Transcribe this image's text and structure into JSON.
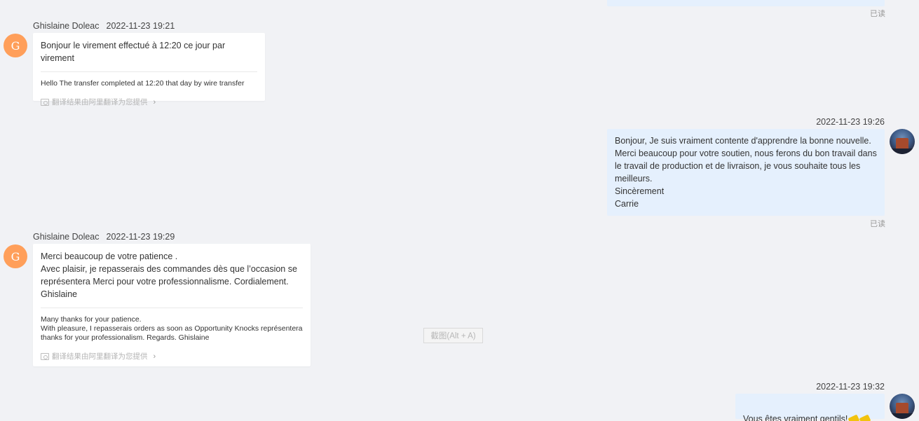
{
  "top": {
    "read_status": "已读"
  },
  "messages": [
    {
      "sender": "Ghislaine Doleac",
      "time": "2022-11-23 19:21",
      "avatar_letter": "G",
      "original": "Bonjour le virement effectué à 12:20 ce jour par virement",
      "translation": "Hello The transfer completed at 12:20 that day by wire transfer",
      "credit": "翻译结果由阿里翻译为您提供"
    },
    {
      "time": "2022-11-23 19:26",
      "text": "Bonjour, Je suis vraiment contente d'apprendre la bonne nouvelle.\nMerci beaucoup pour votre soutien, nous ferons du bon travail dans\nle travail de production et de livraison, je vous souhaite tous les\nmeilleurs.\nSincèrement\nCarrie",
      "read_status": "已读"
    },
    {
      "sender": "Ghislaine Doleac",
      "time": "2022-11-23 19:29",
      "avatar_letter": "G",
      "original": "Merci beaucoup de votre patience .\nAvec plaisir, je repasserais des commandes dès que l’occasion se\nreprésentera Merci pour votre professionnalisme. Cordialement.\nGhislaine",
      "translation": "Many thanks for your patience.\nWith pleasure, I repasserais orders as soon as Opportunity Knocks représentera\nthanks for your professionalism. Regards. Ghislaine",
      "credit": "翻译结果由阿里翻译为您提供"
    },
    {
      "time": "2022-11-23 19:32",
      "text": "Vous êtes vraiment gentils!"
    }
  ],
  "screenshot_tip": "截图(Alt + A)"
}
